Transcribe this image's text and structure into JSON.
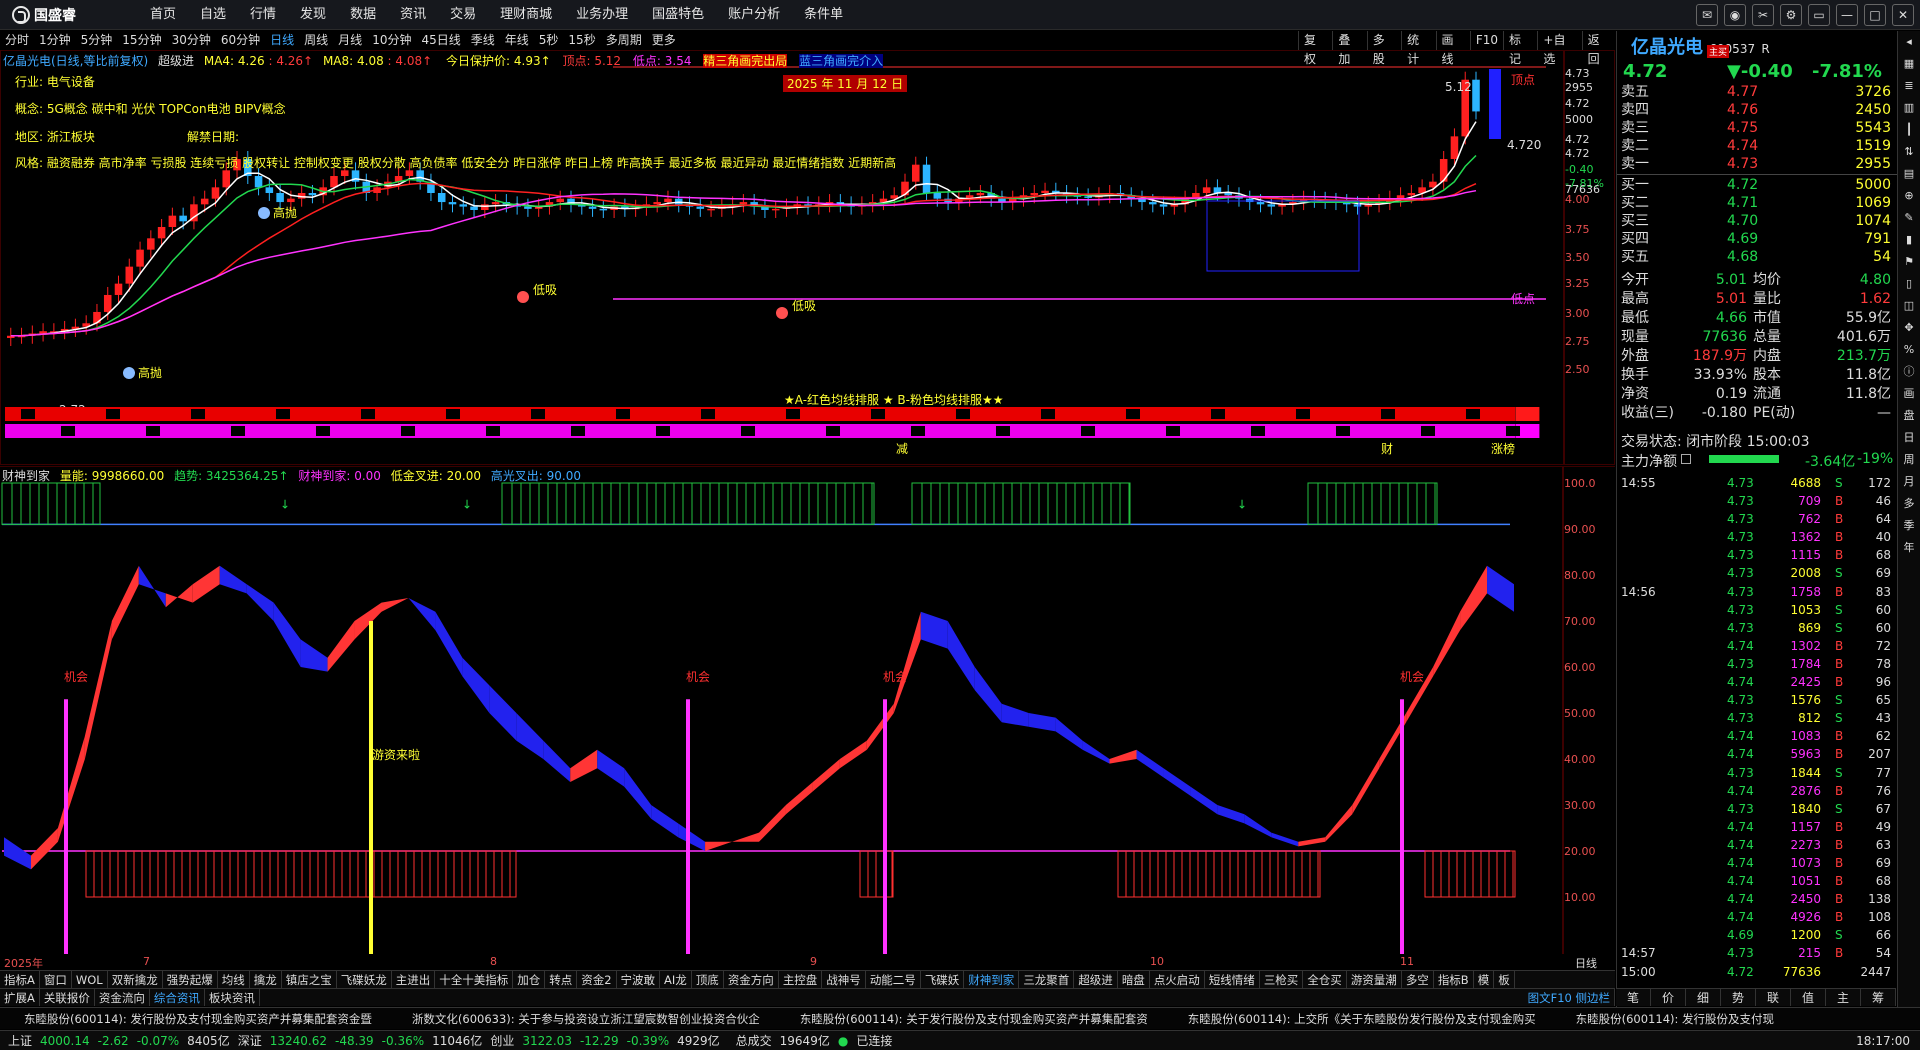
{
  "menubar": {
    "brand": "国盛睿",
    "items": [
      "首页",
      "自选",
      "行情",
      "发现",
      "数据",
      "资讯",
      "交易",
      "理财商城",
      "业务办理",
      "国盛特色",
      "账户分析",
      "条件单"
    ]
  },
  "timeframes": [
    "分时",
    "1分钟",
    "5分钟",
    "15分钟",
    "30分钟",
    "60分钟",
    "日线",
    "周线",
    "月线",
    "10分钟",
    "45日线",
    "季线",
    "年线",
    "5秒",
    "15秒",
    "多周期",
    "更多"
  ],
  "active_timeframe": "日线",
  "toolbar": [
    "复权",
    "叠加",
    "多股",
    "统计",
    "画线",
    "F10",
    "标记",
    "+自选",
    "返回"
  ],
  "main_info": {
    "stock": "亿晶光电(日线,等比前复权)",
    "indicator": "超级进",
    "ma4_label": "MA4: 4.26",
    "ma4_delta": ": 4.26↑",
    "ma8_label": "MA8: 4.08",
    "ma8_delta": ": 4.08↑",
    "protect_price": "今日保护价: 4.93↑",
    "top_point": "顶点: 5.12",
    "low_point": "低点: 3.54",
    "triangle": "精三角画完出局",
    "triangle2": "蓝三角画完介入",
    "industry": "行业: 电气设备",
    "concept": "概念: 5G概念 碳中和 光伏 TOPCon电池 BIPV概念",
    "region": "地区: 浙江板块",
    "release": "解禁日期:",
    "style": "风格: 融资融券 高市净率 亏损股 连续亏损 股权转让 控制权变更 股权分散 高负债率 低安全分 昨日涨停 昨日上榜 昨高换手 最近多板 最近异动 最近情绪指数 近期新高",
    "date_note": "2025 年 11 月 12 日",
    "ma_note": "★A-红色均线排服 ★ B-粉色均线排服★★",
    "label_high": "高抛",
    "label_low": "低吸",
    "label_low_point": "低点",
    "label_top_point": "顶点",
    "value_512": "5.12",
    "value_4720": "4.720",
    "value_272": "←2.72",
    "strip_labels": [
      "减",
      "财",
      "涨榜"
    ]
  },
  "main_yticks": [
    "4.73",
    "2955",
    "4.72",
    "5000",
    "4.72",
    "4.72",
    "-0.40",
    "-7.81%",
    "77636",
    "4.00",
    "3.75",
    "3.50",
    "3.25",
    "3.00",
    "2.75",
    "2.50"
  ],
  "sub_info": {
    "name": "财神到家",
    "volume": "量能: 9998660.00",
    "trend": "趋势: 3425364.25↑",
    "caishen": "财神到家: 0.00",
    "lowgold": "低金叉进: 20.00",
    "highcross": "高光叉出: 90.00",
    "chance": "机会",
    "youzi": "游资来啦"
  },
  "sub_yticks": [
    "100.0",
    "90.00",
    "80.00",
    "70.00",
    "60.00",
    "50.00",
    "40.00",
    "30.00",
    "20.00",
    "10.00"
  ],
  "dates": [
    "2025年",
    "7",
    "8",
    "9",
    "10",
    "11"
  ],
  "datebar_right": "日线",
  "tabs1": [
    "指标A",
    "窗口",
    "WOL",
    "双新擒龙",
    "强势起爆",
    "均线",
    "擒龙",
    "镇店之宝",
    "飞碟妖龙",
    "主进出",
    "十全十美指标",
    "加仓",
    "转点",
    "资金2",
    "宁波敢",
    "AI龙",
    "顶底",
    "资金方向",
    "主控盘",
    "战神号",
    "动能二号",
    "飞碟妖",
    "财神到家",
    "三龙聚首",
    "超级进",
    "暗盘",
    "点火启动",
    "短线情绪",
    "三枪买",
    "全仓买",
    "游资量潮",
    "多空",
    "指标B",
    "模",
    "板"
  ],
  "tabs1_active": "财神到家",
  "tabs2": [
    "扩展A",
    "关联报价",
    "资金流向",
    "综合资讯",
    "板块资讯"
  ],
  "tabs2_active": "综合资讯",
  "tabs2_right": "图文F10 侧边栏",
  "news": [
    "东睦股份(600114): 发行股份及支付现金购买资产并募集配套资金暨",
    "浙数文化(600633): 关于参与投资设立浙江望宸数智创业投资合伙企",
    "东睦股份(600114): 关于发行股份及支付现金购买资产并募集配套资",
    "东睦股份(600114): 上交所《关于东睦股份发行股份及支付现金购买",
    "东睦股份(600114): 发行股份及支付现"
  ],
  "status": {
    "sh_label": "上证",
    "sh_val": "4000.14",
    "sh_chg": "-2.62",
    "sh_pct": "-0.07%",
    "sh_amt": "8405亿",
    "sz_label": "深证",
    "sz_val": "13240.62",
    "sz_chg": "-48.39",
    "sz_pct": "-0.36%",
    "sz_amt": "11046亿",
    "cy_label": "创业",
    "cy_val": "3122.03",
    "cy_chg": "-12.29",
    "cy_pct": "-0.39%",
    "cy_amt": "4929亿",
    "total_label": "总成交",
    "total_val": "19649亿",
    "conn": "已连接",
    "time": "18:17:00"
  },
  "right": {
    "name": "亿晶光电",
    "code": "600537",
    "badge": "主买",
    "mark": "R",
    "price": "4.72",
    "change": "▼-0.40",
    "pct": "-7.81%",
    "asks": [
      [
        "卖五",
        "4.77",
        "3726"
      ],
      [
        "卖四",
        "4.76",
        "2450"
      ],
      [
        "卖三",
        "4.75",
        "5543"
      ],
      [
        "卖二",
        "4.74",
        "1519"
      ],
      [
        "卖一",
        "4.73",
        "2955"
      ]
    ],
    "bids": [
      [
        "买一",
        "4.72",
        "5000"
      ],
      [
        "买二",
        "4.71",
        "1069"
      ],
      [
        "买三",
        "4.70",
        "1074"
      ],
      [
        "买四",
        "4.69",
        "791"
      ],
      [
        "买五",
        "4.68",
        "54"
      ]
    ],
    "stats": [
      [
        "今开",
        "5.01",
        "均价",
        "4.80"
      ],
      [
        "最高",
        "5.01",
        "量比",
        "1.62"
      ],
      [
        "最低",
        "4.66",
        "市值",
        "55.9亿"
      ],
      [
        "现量",
        "77636",
        "总量",
        "401.6万"
      ],
      [
        "外盘",
        "187.9万",
        "内盘",
        "213.7万"
      ],
      [
        "换手",
        "33.93%",
        "股本",
        "11.8亿"
      ],
      [
        "净资",
        "0.19",
        "流通",
        "11.8亿"
      ],
      [
        "收益(三)",
        "-0.180",
        "PE(动)",
        "—"
      ]
    ],
    "trade_state": "交易状态: 闭市阶段 15:00:03",
    "net_label": "主力净额",
    "net_val": "-3.64亿",
    "net_pct": "-19%",
    "trades": [
      [
        "14:55",
        "4.73",
        "4688",
        "S",
        "172"
      ],
      [
        "",
        "4.73",
        "709",
        "B",
        "46"
      ],
      [
        "",
        "4.73",
        "762",
        "B",
        "64"
      ],
      [
        "",
        "4.73",
        "1362",
        "B",
        "40"
      ],
      [
        "",
        "4.73",
        "1115",
        "B",
        "68"
      ],
      [
        "",
        "4.73",
        "2008",
        "S",
        "69"
      ],
      [
        "14:56",
        "4.73",
        "1758",
        "B",
        "83"
      ],
      [
        "",
        "4.73",
        "1053",
        "S",
        "60"
      ],
      [
        "",
        "4.73",
        "869",
        "S",
        "60"
      ],
      [
        "",
        "4.74",
        "1302",
        "B",
        "72"
      ],
      [
        "",
        "4.73",
        "1784",
        "B",
        "78"
      ],
      [
        "",
        "4.74",
        "2425",
        "B",
        "96"
      ],
      [
        "",
        "4.73",
        "1576",
        "S",
        "65"
      ],
      [
        "",
        "4.73",
        "812",
        "S",
        "43"
      ],
      [
        "",
        "4.74",
        "1083",
        "B",
        "62"
      ],
      [
        "",
        "4.74",
        "5963",
        "B",
        "207"
      ],
      [
        "",
        "4.73",
        "1844",
        "S",
        "77"
      ],
      [
        "",
        "4.74",
        "2876",
        "B",
        "76"
      ],
      [
        "",
        "4.73",
        "1840",
        "S",
        "67"
      ],
      [
        "",
        "4.74",
        "1157",
        "B",
        "49"
      ],
      [
        "",
        "4.74",
        "2273",
        "B",
        "63"
      ],
      [
        "",
        "4.74",
        "1073",
        "B",
        "69"
      ],
      [
        "",
        "4.74",
        "1051",
        "B",
        "68"
      ],
      [
        "",
        "4.74",
        "2450",
        "B",
        "138"
      ],
      [
        "",
        "4.74",
        "4926",
        "B",
        "108"
      ],
      [
        "",
        "4.69",
        "1200",
        "S",
        "66"
      ],
      [
        "14:57",
        "4.73",
        "215",
        "B",
        "54"
      ],
      [
        "15:00",
        "4.72",
        "77636",
        "",
        "2447"
      ]
    ],
    "tabs": [
      "笔",
      "价",
      "细",
      "势",
      "联",
      "值",
      "主",
      "筹"
    ]
  },
  "sidebar": [
    "画",
    "盘",
    "日",
    "周",
    "月",
    "多",
    "季",
    "年"
  ]
}
